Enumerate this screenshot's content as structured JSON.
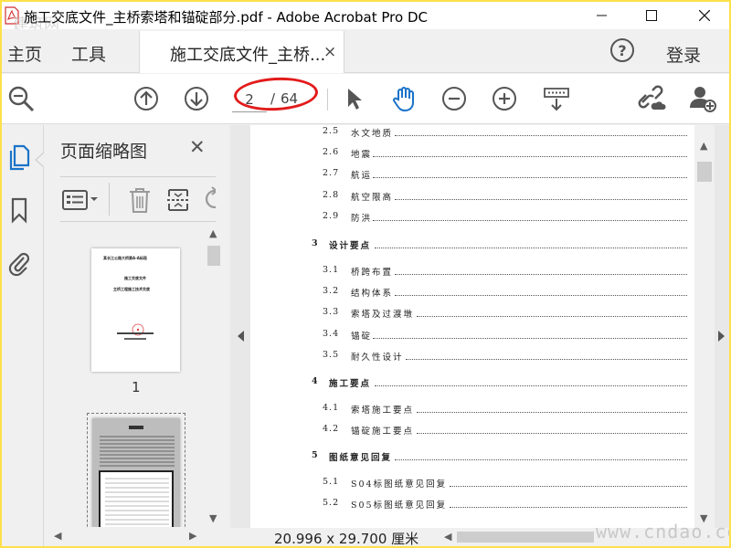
{
  "window": {
    "title": "施工交底文件_主桥索塔和锚碇部分.pdf - Adobe Acrobat Pro DC",
    "watermark": "建筑网"
  },
  "menu": {
    "home": "主页",
    "tools": "工具",
    "tab_label": "施工交底文件_主桥...",
    "tab_close": "×",
    "help": "?",
    "login": "登录"
  },
  "toolbar": {
    "current_page": "2",
    "page_separator": "/",
    "total_pages": "64"
  },
  "thumbnails": {
    "title": "页面缩略图",
    "close": "✕",
    "items": [
      {
        "label": "1",
        "title_lines": [
          "某长江公路大桥第A-A标段",
          "施工交底文件",
          "主桥工程施工技术交底"
        ]
      }
    ]
  },
  "toc": [
    {
      "num": "2.5",
      "text": "水文地质",
      "section": false
    },
    {
      "num": "2.6",
      "text": "地震",
      "section": false
    },
    {
      "num": "2.7",
      "text": "航运",
      "section": false
    },
    {
      "num": "2.8",
      "text": "航空限高",
      "section": false
    },
    {
      "num": "2.9",
      "text": "防洪",
      "section": false
    },
    {
      "num": "3",
      "text": "设计要点",
      "section": true
    },
    {
      "num": "3.1",
      "text": "桥跨布置",
      "section": false
    },
    {
      "num": "3.2",
      "text": "结构体系",
      "section": false
    },
    {
      "num": "3.3",
      "text": "索塔及过渡墩",
      "section": false
    },
    {
      "num": "3.4",
      "text": "锚碇",
      "section": false
    },
    {
      "num": "3.5",
      "text": "耐久性设计",
      "section": false
    },
    {
      "num": "4",
      "text": "施工要点",
      "section": true
    },
    {
      "num": "4.1",
      "text": "索塔施工要点",
      "section": false
    },
    {
      "num": "4.2",
      "text": "锚碇施工要点",
      "section": false
    },
    {
      "num": "5",
      "text": "图纸意见回复",
      "section": true
    },
    {
      "num": "5.1",
      "text": "S04标图纸意见回复",
      "section": false
    },
    {
      "num": "5.2",
      "text": "S05标图纸意见回复",
      "section": false
    }
  ],
  "status": {
    "page_size": "20.996 x 29.700 厘米"
  },
  "site_watermark": "www.cndao.com",
  "colors": {
    "accent_blue": "#1a73c8",
    "annotation_red": "#e21b1b",
    "border_yellow": "#ffe14a"
  }
}
